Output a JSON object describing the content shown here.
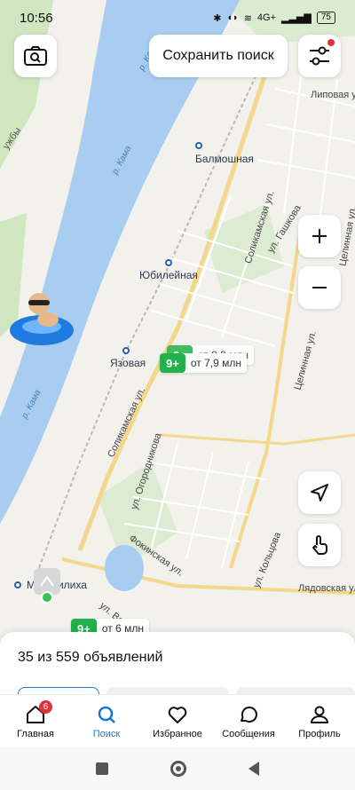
{
  "status_bar": {
    "time": "10:56",
    "network": "4G+",
    "battery": "75"
  },
  "top": {
    "save_search_label": "Сохранить поиск"
  },
  "map": {
    "stations": [
      {
        "name": "Балмошная"
      },
      {
        "name": "Юбилейная"
      },
      {
        "name": "Язовая"
      },
      {
        "name": "Мотовилиха"
      }
    ],
    "streets": [
      "Соликамская ул.",
      "ул. Гашкова",
      "Целинная ул.",
      "ул. Огородникова",
      "Фокинская ул.",
      "ул. Кольцова",
      "Лядовская ул.",
      "Липовая ул.",
      "Целинная ул.",
      "ул. Во"
    ],
    "rivers": [
      "р. Кама",
      "р. Кама",
      "р. Кама"
    ],
    "area_labels": [
      "ужбы"
    ],
    "pins": [
      {
        "count": "9+",
        "price": "от 9,3 млн"
      },
      {
        "count": "9+",
        "price": "от 7,9 млн"
      },
      {
        "count": "9+",
        "price": "от 6 млн"
      }
    ]
  },
  "sheet": {
    "count_text": "35 из 559 объявлений"
  },
  "tabs": [
    {
      "label": "Главная",
      "badge": "6",
      "icon": "home-icon"
    },
    {
      "label": "Поиск",
      "icon": "search-icon"
    },
    {
      "label": "Избранное",
      "icon": "heart-icon"
    },
    {
      "label": "Сообщения",
      "icon": "chat-icon"
    },
    {
      "label": "Профиль",
      "icon": "profile-icon"
    }
  ],
  "colors": {
    "accent": "#1976d2",
    "pin_green": "#22b14c",
    "badge_red": "#e0303a",
    "water": "#a8cdf0"
  }
}
